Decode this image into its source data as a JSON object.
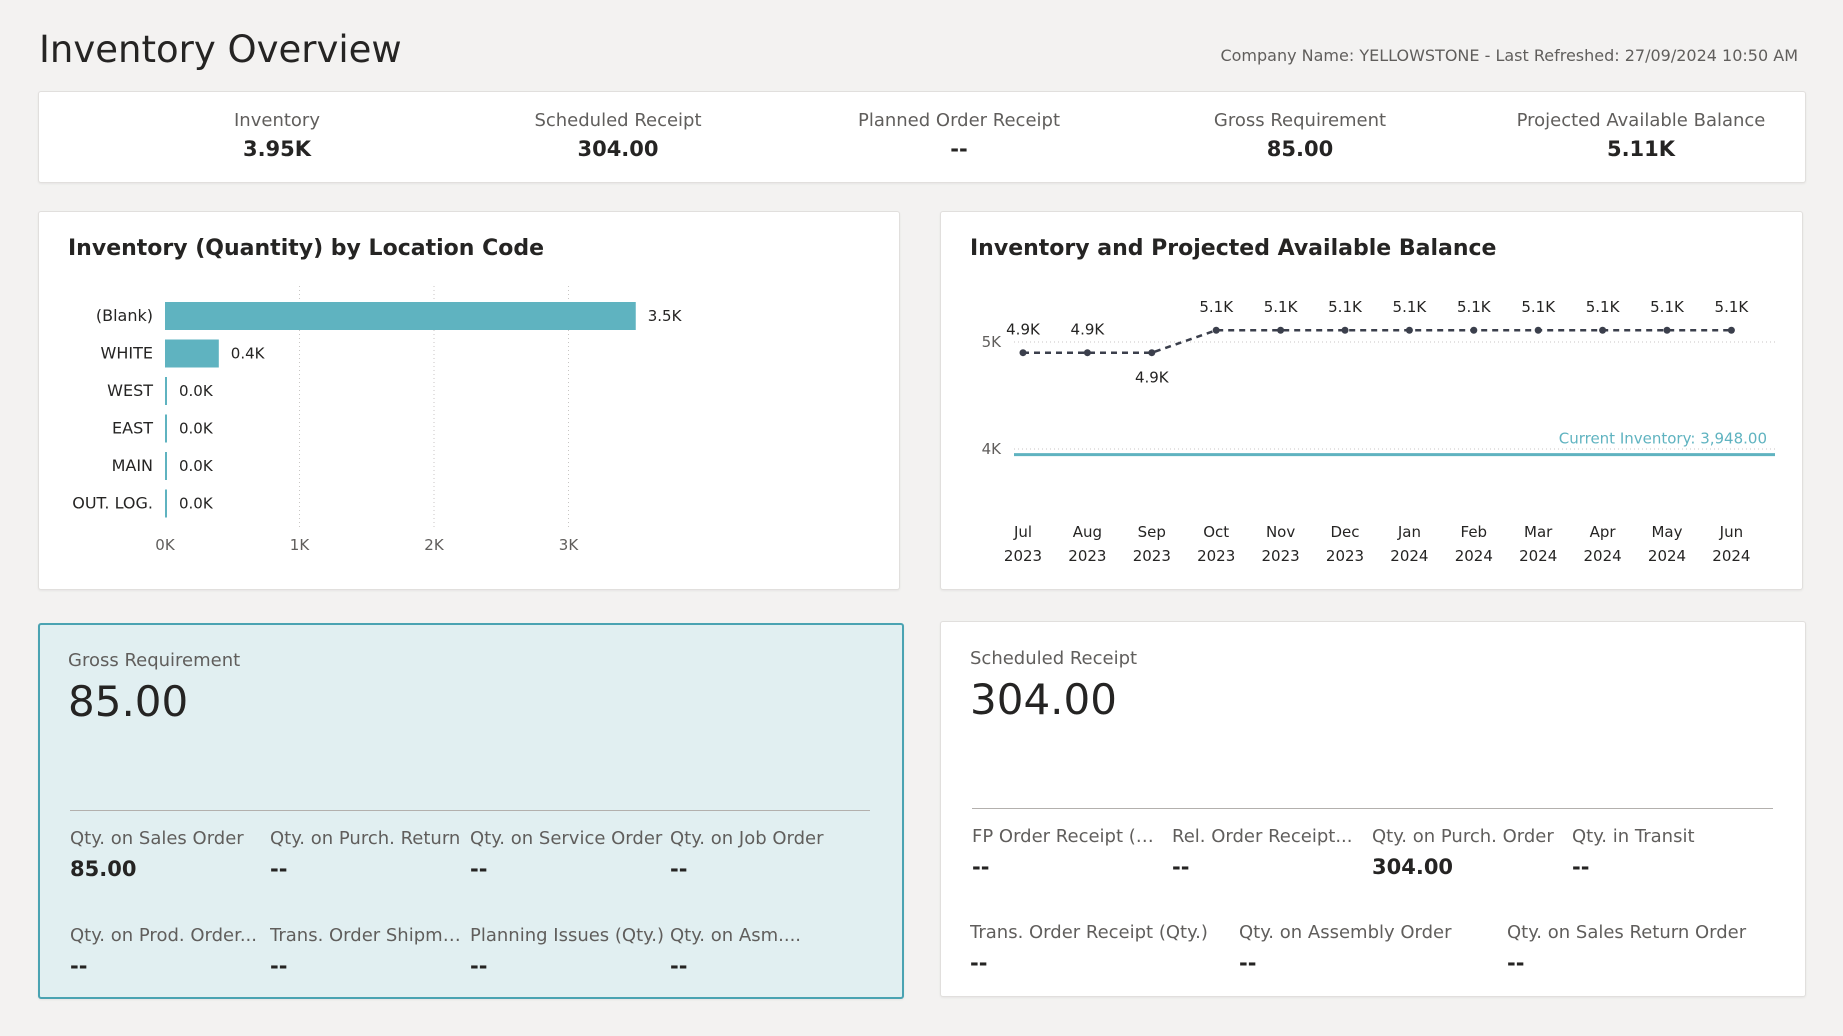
{
  "header": {
    "title": "Inventory Overview",
    "company_info": "Company Name: YELLOWSTONE - Last Refreshed: 27/09/2024 10:50 AM"
  },
  "kpis": [
    {
      "label": "Inventory",
      "value": "3.95K"
    },
    {
      "label": "Scheduled Receipt",
      "value": "304.00"
    },
    {
      "label": "Planned Order Receipt",
      "value": "--"
    },
    {
      "label": "Gross Requirement",
      "value": "85.00"
    },
    {
      "label": "Projected Available Balance",
      "value": "5.11K"
    }
  ],
  "chart_data": [
    {
      "type": "bar",
      "orientation": "horizontal",
      "title": "Inventory (Quantity) by Location Code",
      "categories": [
        "(Blank)",
        "WHITE",
        "WEST",
        "EAST",
        "MAIN",
        "OUT. LOG."
      ],
      "values": [
        3.5,
        0.4,
        0.0,
        0.0,
        0.0,
        0.0
      ],
      "value_labels": [
        "3.5K",
        "0.4K",
        "0.0K",
        "0.0K",
        "0.0K",
        "0.0K"
      ],
      "x_ticks": [
        "0K",
        "1K",
        "2K",
        "3K"
      ],
      "xlim": [
        0,
        4
      ],
      "grid": true,
      "color": "#5fb3c0"
    },
    {
      "type": "line",
      "title": "Inventory and Projected Available Balance",
      "x_top": [
        "Jul",
        "Aug",
        "Sep",
        "Oct",
        "Nov",
        "Dec",
        "Jan",
        "Feb",
        "Mar",
        "Apr",
        "May",
        "Jun"
      ],
      "x_bottom": [
        "2023",
        "2023",
        "2023",
        "2023",
        "2023",
        "2023",
        "2024",
        "2024",
        "2024",
        "2024",
        "2024",
        "2024"
      ],
      "y_ticks": [
        "5K",
        "4K"
      ],
      "ylim": [
        3300,
        5600
      ],
      "series": [
        {
          "style": "dashed",
          "color": "#3b3f4c",
          "values": [
            4900,
            4900,
            4900,
            5110,
            5110,
            5110,
            5110,
            5110,
            5110,
            5110,
            5110,
            5110
          ],
          "labels": [
            "4.9K",
            "4.9K",
            "4.9K",
            "5.1K",
            "5.1K",
            "5.1K",
            "5.1K",
            "5.1K",
            "5.1K",
            "5.1K",
            "5.1K",
            "5.1K"
          ]
        }
      ],
      "reference_line": {
        "value": 3948,
        "label": "Current Inventory: 3,948.00",
        "color": "#5fb3c0"
      },
      "grid": true
    }
  ],
  "gross_requirement": {
    "title": "Gross Requirement",
    "value": "85.00",
    "fields": [
      {
        "label": "Qty. on Sales Order",
        "value": "85.00"
      },
      {
        "label": "Qty. on Purch. Return",
        "value": "--"
      },
      {
        "label": "Qty. on Service Order",
        "value": "--"
      },
      {
        "label": "Qty. on Job Order",
        "value": "--"
      },
      {
        "label": "Qty. on Prod. Order...",
        "value": "--"
      },
      {
        "label": "Trans. Order Shipmen...",
        "value": "--"
      },
      {
        "label": "Planning Issues (Qty.)",
        "value": "--"
      },
      {
        "label": "Qty. on Asm....",
        "value": "--"
      }
    ]
  },
  "scheduled_receipt": {
    "title": "Scheduled Receipt",
    "value": "304.00",
    "fields": [
      {
        "label": "FP Order Receipt (Qty.)",
        "value": "--"
      },
      {
        "label": "Rel. Order Receipt...",
        "value": "--"
      },
      {
        "label": "Qty. on Purch. Order",
        "value": "304.00"
      },
      {
        "label": "Qty. in Transit",
        "value": "--"
      },
      {
        "label": "Trans. Order Receipt (Qty.)",
        "value": "--"
      },
      {
        "label": "Qty. on Assembly Order",
        "value": "--"
      },
      {
        "label": "Qty. on Sales Return Order",
        "value": "--"
      }
    ]
  },
  "colors": {
    "accent": "#5fb3c0",
    "selected_card_bg": "#e1eff1",
    "selected_card_border": "#4aa3b2",
    "line_series": "#3b3f4c"
  }
}
